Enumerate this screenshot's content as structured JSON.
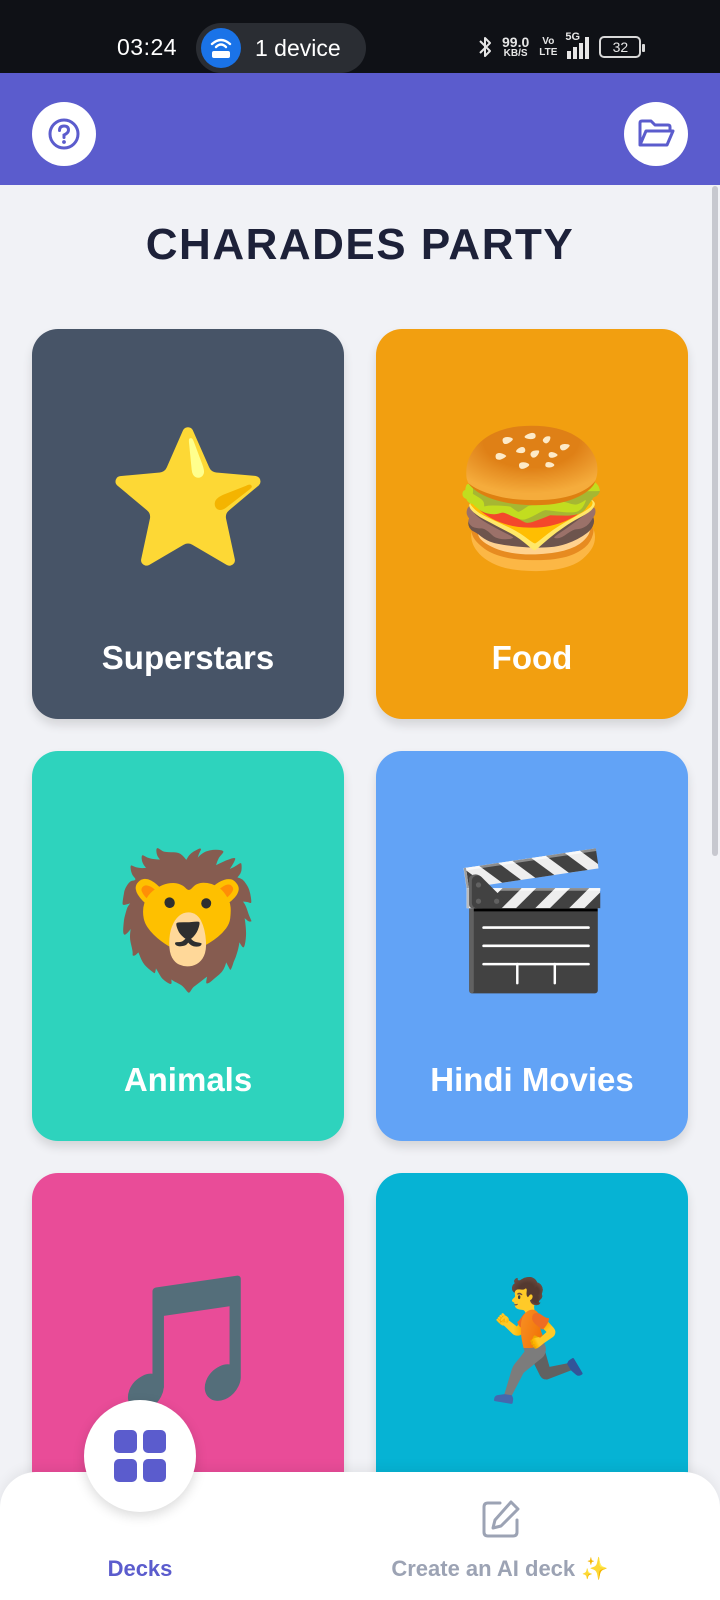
{
  "status_bar": {
    "time": "03:24",
    "hotspot_label": "1 device",
    "net_speed": "99.0",
    "net_unit": "KB/S",
    "volte_top": "Vo",
    "volte_bottom": "LTE",
    "network": "5G",
    "battery": "32"
  },
  "header": {
    "help_icon": "help-circle-icon",
    "folder_icon": "folder-open-icon",
    "color": "#5b5ccd"
  },
  "title": "CHARADES PARTY",
  "decks": [
    {
      "label": "Superstars",
      "emoji": "⭐",
      "color": "#475467"
    },
    {
      "label": "Food",
      "emoji": "🍔",
      "color": "#f29f10"
    },
    {
      "label": "Animals",
      "emoji": "🦁",
      "color": "#2ed3bd"
    },
    {
      "label": "Hindi Movies",
      "emoji": "🎬",
      "color": "#62a3f6"
    },
    {
      "label": "",
      "emoji": "🎵",
      "color": "#e94c98"
    },
    {
      "label": "",
      "emoji": "🏃",
      "color": "#06b3d4"
    }
  ],
  "bottom_nav": {
    "decks_label": "Decks",
    "ai_label": "Create an AI deck ✨",
    "active_color": "#5b5ccd"
  }
}
